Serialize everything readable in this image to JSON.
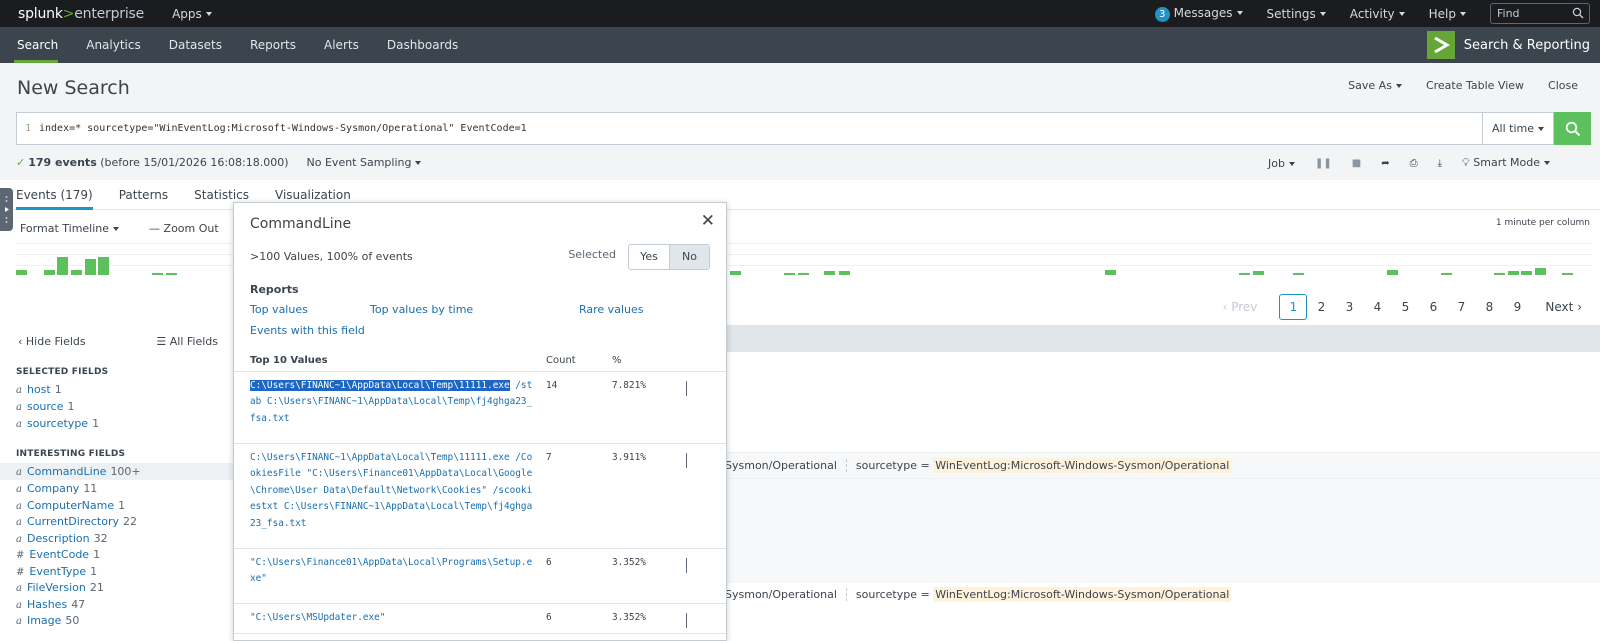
{
  "topbar": {
    "logo_main": "splunk",
    "logo_sep": ">",
    "logo_product": "enterprise",
    "apps": "Apps",
    "messages_count": "3",
    "messages": "Messages",
    "settings": "Settings",
    "activity": "Activity",
    "help": "Help",
    "find_placeholder": "Find"
  },
  "appbar": {
    "items": [
      "Search",
      "Analytics",
      "Datasets",
      "Reports",
      "Alerts",
      "Dashboards"
    ],
    "app_title": "Search & Reporting"
  },
  "header": {
    "title": "New Search",
    "save_as": "Save As",
    "create_table_view": "Create Table View",
    "close": "Close"
  },
  "search": {
    "line_number": "1",
    "query": "index=* sourcetype=\"WinEventLog:Microsoft-Windows-Sysmon/Operational\" EventCode=1",
    "time_range": "All time"
  },
  "status": {
    "events": "179 events",
    "before": "(before 15/01/2026 16:08:18.000)",
    "sampling": "No Event Sampling",
    "job": "Job",
    "mode": "Smart Mode"
  },
  "tabs": [
    "Events (179)",
    "Patterns",
    "Statistics",
    "Visualization"
  ],
  "timeline": {
    "format": "Format Timeline",
    "zoom_out": "Zoom Out",
    "scale": "1 minute per column",
    "bars": [
      {
        "pos": 0.0,
        "h": 0.15
      },
      {
        "pos": 0.018,
        "h": 0.15
      },
      {
        "pos": 0.026,
        "h": 0.55
      },
      {
        "pos": 0.035,
        "h": 0.15
      },
      {
        "pos": 0.044,
        "h": 0.5
      },
      {
        "pos": 0.052,
        "h": 0.55
      },
      {
        "pos": 0.086,
        "h": 0.07
      },
      {
        "pos": 0.095,
        "h": 0.07
      },
      {
        "pos": 0.453,
        "h": 0.12
      },
      {
        "pos": 0.487,
        "h": 0.07
      },
      {
        "pos": 0.496,
        "h": 0.07
      },
      {
        "pos": 0.513,
        "h": 0.12
      },
      {
        "pos": 0.522,
        "h": 0.12
      },
      {
        "pos": 0.691,
        "h": 0.17
      },
      {
        "pos": 0.776,
        "h": 0.07
      },
      {
        "pos": 0.785,
        "h": 0.12
      },
      {
        "pos": 0.81,
        "h": 0.07
      },
      {
        "pos": 0.87,
        "h": 0.17
      },
      {
        "pos": 0.904,
        "h": 0.07
      },
      {
        "pos": 0.938,
        "h": 0.07
      },
      {
        "pos": 0.947,
        "h": 0.12
      },
      {
        "pos": 0.955,
        "h": 0.12
      },
      {
        "pos": 0.964,
        "h": 0.22
      },
      {
        "pos": 0.981,
        "h": 0.07
      }
    ]
  },
  "pager": {
    "prev": "Prev",
    "pages": [
      "1",
      "2",
      "3",
      "4",
      "5",
      "6",
      "7",
      "8",
      "9"
    ],
    "next": "Next"
  },
  "fields": {
    "hide": "Hide Fields",
    "all": "All Fields",
    "selected_title": "SELECTED FIELDS",
    "selected": [
      {
        "type": "a",
        "name": "host",
        "count": "1"
      },
      {
        "type": "a",
        "name": "source",
        "count": "1"
      },
      {
        "type": "a",
        "name": "sourcetype",
        "count": "1"
      }
    ],
    "interesting_title": "INTERESTING FIELDS",
    "interesting": [
      {
        "type": "a",
        "name": "CommandLine",
        "count": "100+"
      },
      {
        "type": "a",
        "name": "Company",
        "count": "11"
      },
      {
        "type": "a",
        "name": "ComputerName",
        "count": "1"
      },
      {
        "type": "a",
        "name": "CurrentDirectory",
        "count": "22"
      },
      {
        "type": "a",
        "name": "Description",
        "count": "32"
      },
      {
        "type": "#",
        "name": "EventCode",
        "count": "1"
      },
      {
        "type": "#",
        "name": "EventType",
        "count": "1"
      },
      {
        "type": "a",
        "name": "FileVersion",
        "count": "21"
      },
      {
        "type": "a",
        "name": "Hashes",
        "count": "47"
      },
      {
        "type": "a",
        "name": "Image",
        "count": "50"
      }
    ]
  },
  "events": {
    "source_tail": "Sysmon/Operational",
    "sourcetype_label": "sourcetype =",
    "sourcetype_value": "WinEventLog:Microsoft-Windows-Sysmon/Operational"
  },
  "popup": {
    "title": "CommandLine",
    "summary": ">100 Values, 100% of events",
    "selected_label": "Selected",
    "yes": "Yes",
    "no": "No",
    "reports_title": "Reports",
    "top_values": "Top values",
    "top_values_by_time": "Top values by time",
    "rare_values": "Rare values",
    "events_with_field": "Events with this field",
    "col_values": "Top 10 Values",
    "col_count": "Count",
    "col_pct": "%",
    "rows": [
      {
        "sel": "C:\\Users\\FINANC~1\\AppData\\Local\\Temp\\11111.exe",
        "text": " /stab C:\\Users\\FINANC~1\\AppData\\Local\\Temp\\fj4ghga23_fsa.txt",
        "count": "14",
        "pct": "7.821%"
      },
      {
        "sel": "",
        "text": "C:\\Users\\FINANC~1\\AppData\\Local\\Temp\\11111.exe /CookiesFile \"C:\\Users\\Finance01\\AppData\\Local\\Google\\Chrome\\User Data\\Default\\Network\\Cookies\" /scookiestxt C:\\Users\\FINANC~1\\AppData\\Local\\Temp\\fj4ghga23_fsa.txt",
        "count": "7",
        "pct": "3.911%"
      },
      {
        "sel": "",
        "text": "\"C:\\Users\\Finance01\\AppData\\Local\\Programs\\Setup.exe\"",
        "count": "6",
        "pct": "3.352%"
      },
      {
        "sel": "",
        "text": "\"C:\\Users\\MSUpdater.exe\"",
        "count": "6",
        "pct": "3.352%"
      }
    ]
  }
}
